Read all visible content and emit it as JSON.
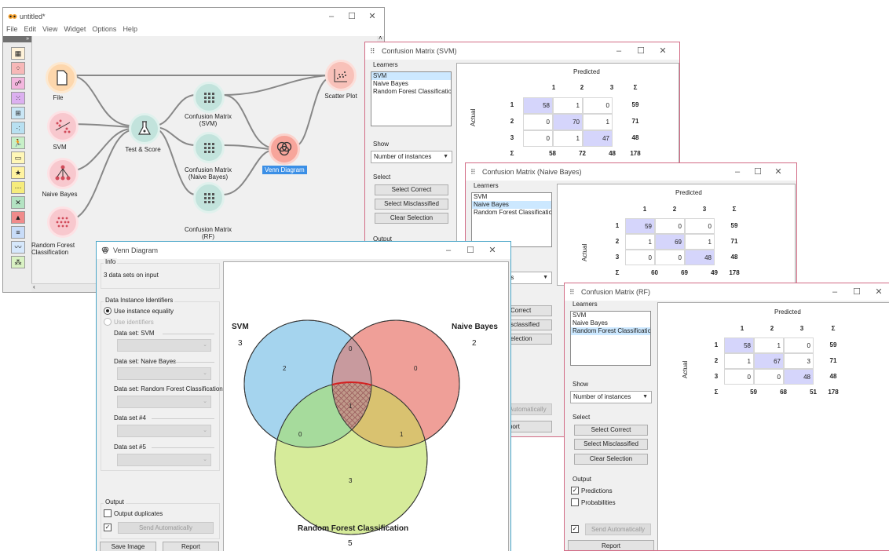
{
  "canvas": {
    "title": "untitled*",
    "menu": [
      "File",
      "Edit",
      "View",
      "Widget",
      "Options",
      "Help"
    ],
    "nodes": {
      "file": "File",
      "svm": "SVM",
      "naive": "Naive Bayes",
      "rf": "Random Forest Classification",
      "test": "Test & Score",
      "cm_svm": "Confusion Matrix (SVM)",
      "cm_nb": "Confusion Matrix (Naive Bayes)",
      "cm_rf": "Confusion Matrix (RF)",
      "venn": "Venn Diagram",
      "scatter": "Scatter Plot"
    },
    "colors": {
      "file": "#fdc98c",
      "learner": "#f9b3bb",
      "eval": "#a9d7ce",
      "viz": "#f79b8f",
      "scatter": "#f6b4ab"
    }
  },
  "cm_svm": {
    "title": "Confusion Matrix (SVM)",
    "learners_label": "Learners",
    "learners": [
      "SVM",
      "Naive Bayes",
      "Random Forest Classification"
    ],
    "selected": 0,
    "show_label": "Show",
    "show_value": "Number of instances",
    "select_label": "Select",
    "btn_correct": "Select Correct",
    "btn_mis": "Select Misclassified",
    "btn_clear": "Clear Selection",
    "output_label": "Output",
    "predicted": "Predicted",
    "actual": "Actual",
    "cols": [
      "1",
      "2",
      "3",
      "Σ"
    ],
    "rows": [
      "1",
      "2",
      "3",
      "Σ"
    ],
    "matrix": [
      [
        "58",
        "1",
        "0",
        "59"
      ],
      [
        "0",
        "70",
        "1",
        "71"
      ],
      [
        "0",
        "1",
        "47",
        "48"
      ],
      [
        "58",
        "72",
        "48",
        "178"
      ]
    ]
  },
  "cm_nb": {
    "title": "Confusion Matrix (Naive Bayes)",
    "learners_label": "Learners",
    "learners": [
      "SVM",
      "Naive Bayes",
      "Random Forest Classificatio"
    ],
    "show_partial": "ances",
    "btn_correct_partial": "Correct",
    "btn_mis_partial": "sclassified",
    "btn_clear_partial": "election",
    "send_partial": "Automatically",
    "report_partial": "port",
    "predicted": "Predicted",
    "actual": "Actual",
    "cols": [
      "1",
      "2",
      "3",
      "Σ"
    ],
    "rows": [
      "1",
      "2",
      "3",
      "Σ"
    ],
    "matrix": [
      [
        "59",
        "0",
        "0",
        "59"
      ],
      [
        "1",
        "69",
        "1",
        "71"
      ],
      [
        "0",
        "0",
        "48",
        "48"
      ],
      [
        "60",
        "69",
        "49",
        "178"
      ]
    ]
  },
  "cm_rf": {
    "title": "Confusion Matrix (RF)",
    "learners_label": "Learners",
    "learners": [
      "SVM",
      "Naive Bayes",
      "Random Forest Classificatio"
    ],
    "show_label": "Show",
    "show_value": "Number of instances",
    "select_label": "Select",
    "btn_correct": "Select Correct",
    "btn_mis": "Select Misclassified",
    "btn_clear": "Clear Selection",
    "output_label": "Output",
    "predictions": "Predictions",
    "probabilities": "Probabilities",
    "send": "Send Automatically",
    "report": "Report",
    "predicted": "Predicted",
    "actual": "Actual",
    "cols": [
      "1",
      "2",
      "3",
      "Σ"
    ],
    "rows": [
      "1",
      "2",
      "3",
      "Σ"
    ],
    "matrix": [
      [
        "58",
        "1",
        "0",
        "59"
      ],
      [
        "1",
        "67",
        "3",
        "71"
      ],
      [
        "0",
        "0",
        "48",
        "48"
      ],
      [
        "59",
        "68",
        "51",
        "178"
      ]
    ]
  },
  "venn": {
    "title": "Venn Diagram",
    "info_label": "Info",
    "info_text": "3 data sets on input",
    "ids_label": "Data Instance Identifiers",
    "opt_equality": "Use instance equality",
    "opt_ids": "Use identifiers",
    "ds_svm": "Data set: SVM",
    "ds_nb": "Data set: Naive Bayes",
    "ds_rf": "Data set: Random Forest Classification",
    "ds4": "Data set #4",
    "ds5": "Data set #5",
    "output_label": "Output",
    "output_dup": "Output duplicates",
    "send": "Send Automatically",
    "save_image": "Save Image",
    "report": "Report",
    "sets": [
      {
        "name": "SVM",
        "count": "3",
        "color": "#a6d4ee"
      },
      {
        "name": "Naive Bayes",
        "count": "2",
        "color": "#efa7a1"
      },
      {
        "name": "Random Forest Classification",
        "count": "5",
        "color": "#d7ea9a"
      }
    ],
    "regions": {
      "svm_only": "2",
      "nb_only": "0",
      "rf_only": "3",
      "svm_nb": "0",
      "svm_rf": "0",
      "nb_rf": "1",
      "all": "1"
    }
  }
}
